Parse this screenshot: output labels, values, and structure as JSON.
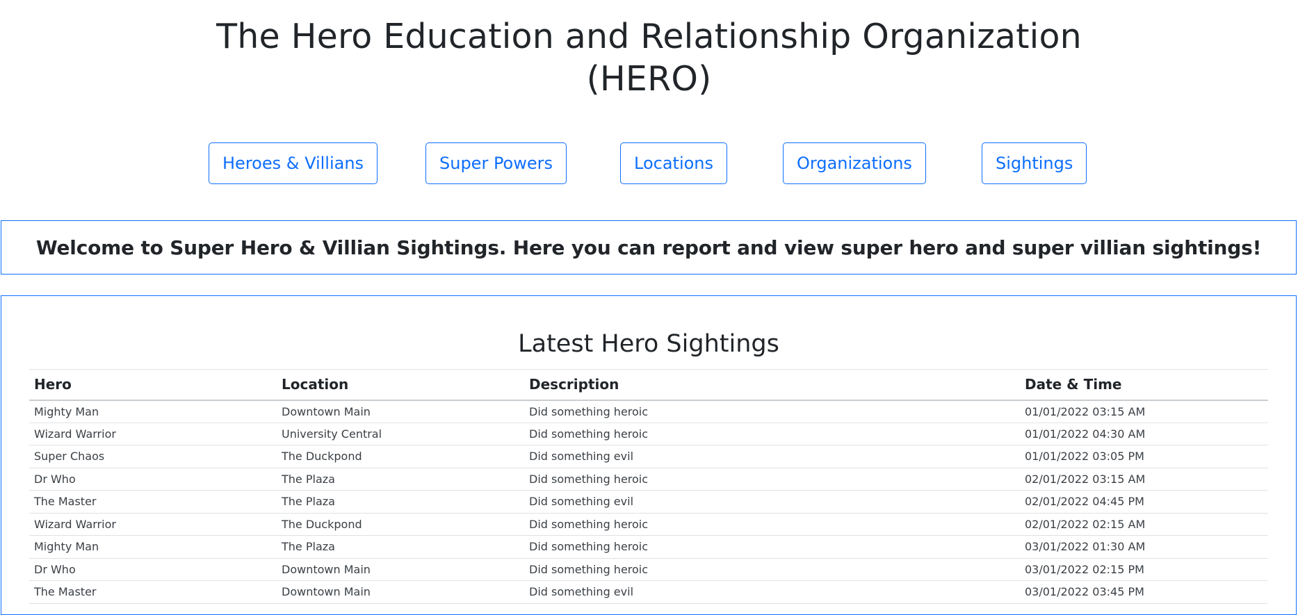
{
  "page": {
    "title_line1": "The Hero Education and Relationship Organization",
    "title_line2": "(HERO)"
  },
  "nav": {
    "items": [
      {
        "label": "Heroes & Villians"
      },
      {
        "label": "Super Powers"
      },
      {
        "label": "Locations"
      },
      {
        "label": "Organizations"
      },
      {
        "label": "Sightings"
      }
    ]
  },
  "welcome": {
    "text": "Welcome to Super Hero & Villian Sightings. Here you can report and view super hero and super villian sightings!"
  },
  "sightings": {
    "title": "Latest Hero Sightings",
    "columns": [
      "Hero",
      "Location",
      "Description",
      "Date & Time"
    ],
    "rows": [
      [
        "Mighty Man",
        "Downtown Main",
        "Did something heroic",
        "01/01/2022 03:15 AM"
      ],
      [
        "Wizard Warrior",
        "University Central",
        "Did something heroic",
        "01/01/2022 04:30 AM"
      ],
      [
        "Super Chaos",
        "The Duckpond",
        "Did something evil",
        "01/01/2022 03:05 PM"
      ],
      [
        "Dr Who",
        "The Plaza",
        "Did something heroic",
        "02/01/2022 03:15 AM"
      ],
      [
        "The Master",
        "The Plaza",
        "Did something evil",
        "02/01/2022 04:45 PM"
      ],
      [
        "Wizard Warrior",
        "The Duckpond",
        "Did something heroic",
        "02/01/2022 02:15 AM"
      ],
      [
        "Mighty Man",
        "The Plaza",
        "Did something heroic",
        "03/01/2022 01:30 AM"
      ],
      [
        "Dr Who",
        "Downtown Main",
        "Did something heroic",
        "03/01/2022 02:15 PM"
      ],
      [
        "The Master",
        "Downtown Main",
        "Did something evil",
        "03/01/2022 03:45 PM"
      ]
    ]
  },
  "colors": {
    "accent": "#0d6efd",
    "text": "#212529",
    "border": "#dee2e6"
  }
}
